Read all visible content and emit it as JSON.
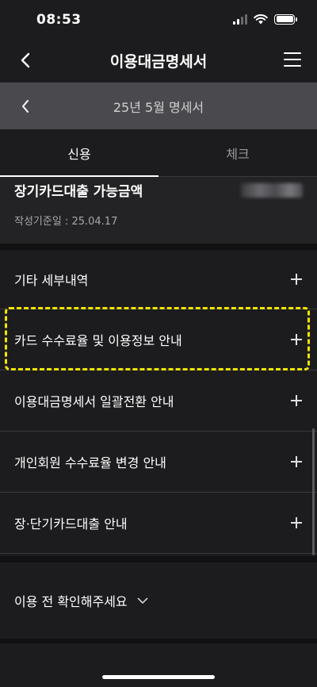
{
  "status_bar": {
    "time": "08:53"
  },
  "header": {
    "title": "이용대금명세서"
  },
  "month_bar": {
    "label": "25년 5월 명세서"
  },
  "tabs": [
    {
      "label": "신용",
      "active": true
    },
    {
      "label": "체크",
      "active": false
    }
  ],
  "summary": {
    "title": "장기카드대출 가능금액",
    "date": "작성기준일 : 25.04.17"
  },
  "list_items": [
    {
      "label": "기타 세부내역"
    },
    {
      "label": "카드 수수료율 및 이용정보 안내"
    },
    {
      "label": "이용대금명세서 일괄전환 안내"
    },
    {
      "label": "개인회원 수수료율 변경 안내"
    },
    {
      "label": "장·단기카드대출 안내"
    }
  ],
  "notice": {
    "label": "이용 전 확인해주세요"
  },
  "colors": {
    "highlight": "#f2e600",
    "background": "#1c1c1e",
    "month_bar": "#4a4a4e"
  }
}
